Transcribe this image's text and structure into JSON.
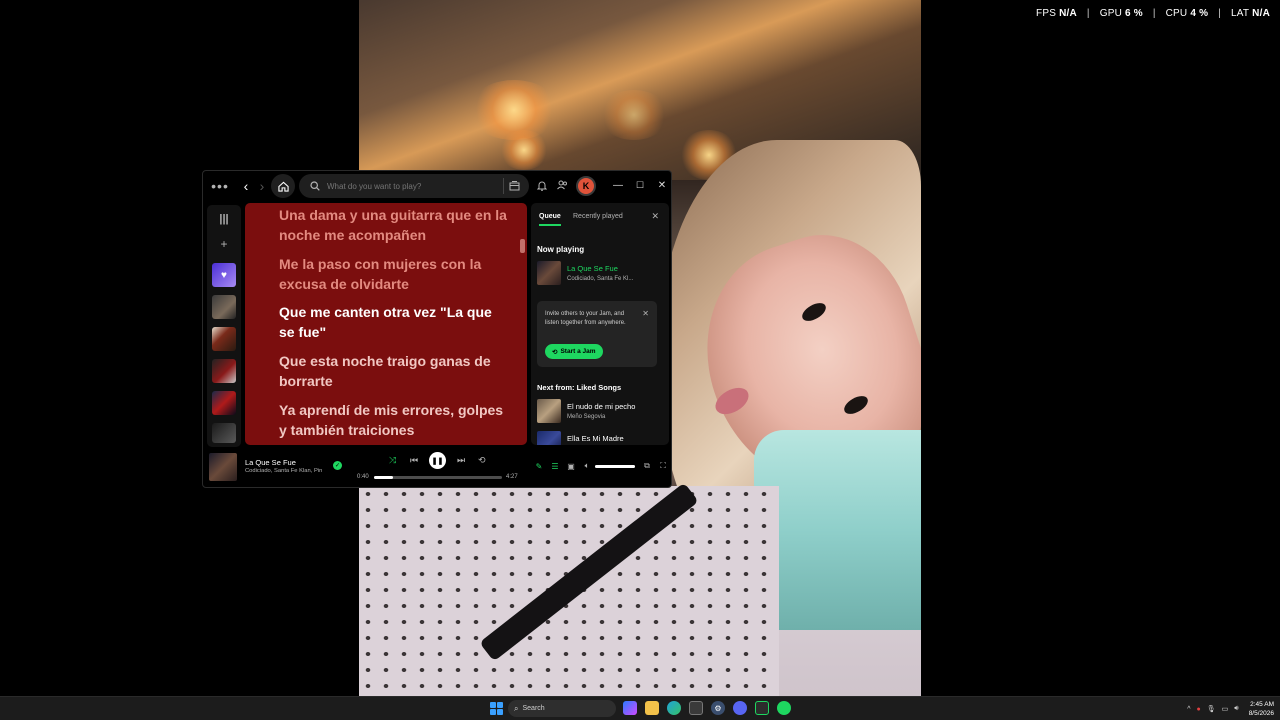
{
  "perf": {
    "fps_label": "FPS",
    "fps_value": "N/A",
    "gpu_label": "GPU",
    "gpu_value": "6 %",
    "cpu_label": "CPU",
    "cpu_value": "4 %",
    "lat_label": "LAT",
    "lat_value": "N/A"
  },
  "titlebar": {
    "search_placeholder": "What do you want to play?",
    "avatar_letter": "K"
  },
  "lyrics": [
    {
      "text": "Una dama y una guitarra que en la noche me acompañen",
      "state": "past"
    },
    {
      "text": "Me la paso con mujeres con la excusa de olvidarte",
      "state": "past"
    },
    {
      "text": "Que me canten otra vez \"La que se fue\"",
      "state": "current"
    },
    {
      "text": "Que esta noche traigo ganas de borrarte",
      "state": "next"
    },
    {
      "text": "Ya aprendí de mis errores, golpes y también traiciones",
      "state": "next"
    }
  ],
  "queue": {
    "tab_queue": "Queue",
    "tab_recent": "Recently played",
    "now_playing_heading": "Now playing",
    "now_playing": {
      "title": "La Que Se Fue",
      "artist": "Codiciado, Santa Fe Kl..."
    },
    "jam_text": "Invite others to your Jam, and listen together from anywhere.",
    "jam_button": "Start a Jam",
    "next_from_heading": "Next from: Liked Songs",
    "next_items": [
      {
        "title": "El nudo de mi pecho",
        "artist": "Meño Segovia"
      },
      {
        "title": "Ella Es Mi Madre",
        "artist": ""
      }
    ]
  },
  "player": {
    "title": "La Que Se Fue",
    "artist": "Codiciado, Santa Fe Klan, Pin",
    "elapsed": "0:40",
    "total": "4:27",
    "progress": 0.15,
    "volume": 1.0
  },
  "taskbar": {
    "search_label": "Search",
    "time": "2:45 AM",
    "date": "8/5/2026"
  },
  "colors": {
    "spotify_green": "#1ed760",
    "lyrics_bg": "#7b0e0e",
    "avatar_bg": "#e0533a"
  }
}
